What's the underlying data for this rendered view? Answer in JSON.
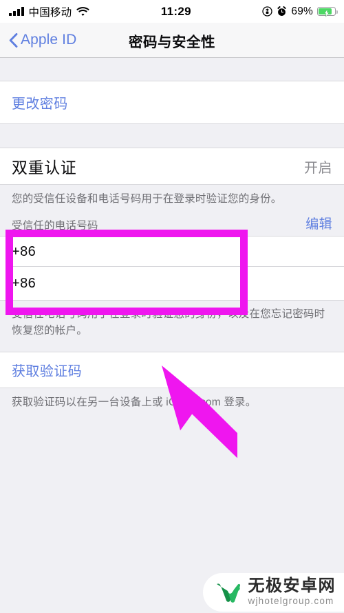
{
  "status_bar": {
    "signal_icon": "signal-bars-icon",
    "carrier": "中国移动",
    "wifi_icon": "wifi-icon",
    "time": "11:29",
    "rotation_lock_icon": "rotation-lock-icon",
    "alarm_icon": "alarm-clock-icon",
    "battery_percent": "69%",
    "battery_icon": "battery-charging-icon",
    "battery_level": 69,
    "battery_color": "#4cd864"
  },
  "nav": {
    "back_icon": "chevron-left-icon",
    "back_label": "Apple ID",
    "title": "密码与安全性",
    "link_color": "#5f7fe0"
  },
  "sections": {
    "password": {
      "change_password_label": "更改密码"
    },
    "two_factor": {
      "title": "双重认证",
      "state_value": "开启",
      "description": "您的受信任设备和电话号码用于在登录时验证您的身份。",
      "trusted_numbers_header": "受信任的电话号码",
      "edit_label": "编辑",
      "numbers": [
        {
          "label": "+86"
        },
        {
          "label": "+86"
        }
      ],
      "footnote": "受信任电话号码用于在登录时验证您的身份，以及在您忘记密码时恢复您的帐户。"
    },
    "verification": {
      "get_code_label": "获取验证码",
      "footnote": "获取验证码以在另一台设备上或 iCloud.com 登录。"
    }
  },
  "annotations": {
    "highlight_color": "#ef16ef",
    "box_name": "trusted-phone-numbers-highlight",
    "cursor_name": "mouse-pointer-annotation"
  },
  "watermark": {
    "logo_icon": "w-logo-icon",
    "brand_cn": "无极安卓网",
    "url": "wjhotelgroup.com",
    "logo_color_dark": "#159048",
    "logo_color_light": "#27b862"
  }
}
